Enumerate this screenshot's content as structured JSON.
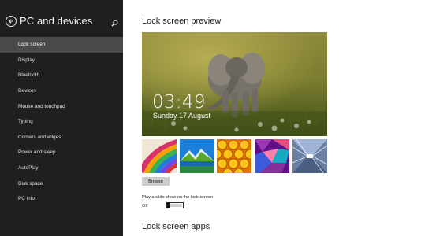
{
  "sidebar": {
    "title": "PC and devices",
    "items": [
      {
        "label": "Lock screen",
        "active": true
      },
      {
        "label": "Display",
        "active": false
      },
      {
        "label": "Bluetooth",
        "active": false
      },
      {
        "label": "Devices",
        "active": false
      },
      {
        "label": "Mouse and touchpad",
        "active": false
      },
      {
        "label": "Typing",
        "active": false
      },
      {
        "label": "Corners and edges",
        "active": false
      },
      {
        "label": "Power and sleep",
        "active": false
      },
      {
        "label": "AutoPlay",
        "active": false
      },
      {
        "label": "Disk space",
        "active": false
      },
      {
        "label": "PC info",
        "active": false
      }
    ]
  },
  "main": {
    "preview_heading": "Lock screen preview",
    "clock": "03:49",
    "date": "Sunday 17 August",
    "thumbnails": [
      "colorful-stripes",
      "mountain-lake",
      "honeycomb",
      "geometric-cubes",
      "tunnel-lights"
    ],
    "browse_label": "Browse",
    "slideshow_label": "Play a slide show on the lock screen",
    "slideshow_state": "Off",
    "apps_heading": "Lock screen apps"
  },
  "colors": {
    "sidebar_bg": "#1f1f1f",
    "sidebar_active": "#4a4a4a",
    "main_bg": "#ffffff"
  },
  "icons": {
    "back": "back-arrow-icon",
    "search": "search-icon"
  }
}
